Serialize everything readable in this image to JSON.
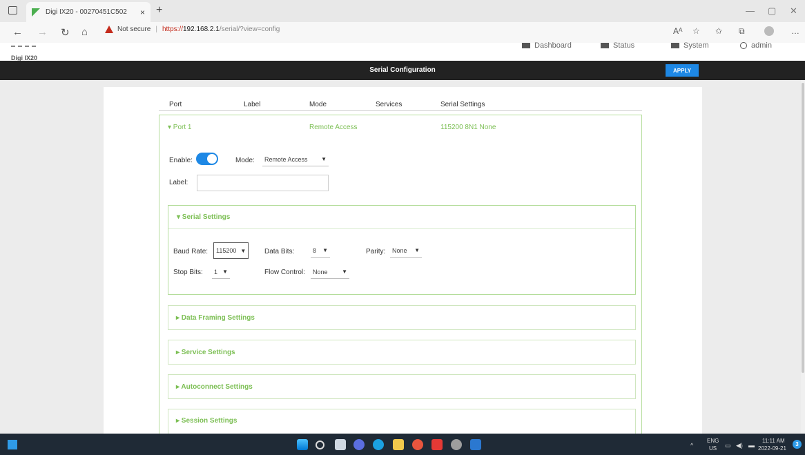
{
  "browser": {
    "tab_title": "Digi IX20 - 00270451C502",
    "tab_close": "×",
    "new_tab": "+",
    "security_label": "Not secure",
    "url_scheme": "https://",
    "url_host": "192.168.2.1",
    "url_path": "/serial/?view=config",
    "window_controls": [
      "—",
      "▢",
      "✕"
    ],
    "nav_back": "←",
    "nav_forward": "→",
    "nav_refresh": "↻",
    "nav_home": "⌂",
    "right_icons": [
      "Aᴬ",
      "☆",
      "✩",
      "⧉",
      "…"
    ]
  },
  "app": {
    "brand": "Digi IX20",
    "nav": [
      "Dashboard",
      "Status",
      "System",
      "admin"
    ],
    "page_title": "Serial Configuration",
    "apply_label": "APPLY"
  },
  "table": {
    "headers": [
      "Port",
      "Label",
      "Mode",
      "Services",
      "Serial Settings"
    ],
    "port_row": {
      "port": "▾  Port 1",
      "mode": "Remote Access",
      "serial": "115200 8N1 None"
    }
  },
  "port_form": {
    "enable_label": "Enable:",
    "enable_on": true,
    "mode_label": "Mode:",
    "mode_value": "Remote Access",
    "label_label": "Label:",
    "label_value": ""
  },
  "serial_settings": {
    "title": "▾  Serial Settings",
    "baud_label": "Baud Rate:",
    "baud_value": "115200",
    "data_bits_label": "Data Bits:",
    "data_bits_value": "8",
    "parity_label": "Parity:",
    "parity_value": "None",
    "stop_bits_label": "Stop Bits:",
    "stop_bits_value": "1",
    "flow_label": "Flow Control:",
    "flow_value": "None"
  },
  "collapsed_sections": [
    "▸  Data Framing Settings",
    "▸  Service Settings",
    "▸  Autoconnect Settings",
    "▸  Session Settings"
  ],
  "taskbar": {
    "lang_top": "ENG",
    "lang_bottom": "US",
    "time": "11:11 AM",
    "date": "2022-09-21"
  },
  "colors": {
    "accent_green": "#7cbf54",
    "accent_blue": "#1e88e5",
    "header_black": "#222222"
  }
}
